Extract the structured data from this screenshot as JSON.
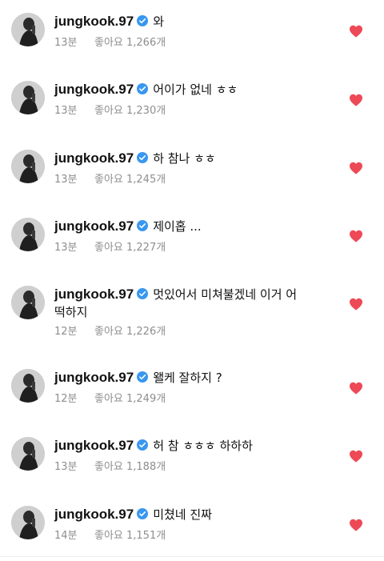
{
  "colors": {
    "heart": "#ed4956",
    "verified": "#3897f0",
    "meta_text": "#8e8e8e"
  },
  "comments": [
    {
      "username": "jungkook.97",
      "text": "와",
      "time": "13분",
      "likes": "좋아요 1,266개"
    },
    {
      "username": "jungkook.97",
      "text": "어이가 없네 ㅎㅎ",
      "time": "13분",
      "likes": "좋아요 1,230개"
    },
    {
      "username": "jungkook.97",
      "text": "하 참나 ㅎㅎ",
      "time": "13분",
      "likes": "좋아요 1,245개"
    },
    {
      "username": "jungkook.97",
      "text": "제이홉 ...",
      "time": "13분",
      "likes": "좋아요 1,227개"
    },
    {
      "username": "jungkook.97",
      "text": "멋있어서 미쳐불겠네 이거 어",
      "text_line2": "떡하지",
      "time": "12분",
      "likes": "좋아요 1,226개"
    },
    {
      "username": "jungkook.97",
      "text": "왤케 잘하지 ?",
      "time": "12분",
      "likes": "좋아요 1,249개"
    },
    {
      "username": "jungkook.97",
      "text": "허 참 ㅎㅎㅎ 하하하",
      "time": "13분",
      "likes": "좋아요 1,188개"
    },
    {
      "username": "jungkook.97",
      "text": "미쳤네 진짜",
      "time": "14분",
      "likes": "좋아요 1,151개"
    }
  ],
  "icons": {
    "avatar": "profile-photo",
    "verified": "verified-badge-icon",
    "like": "heart-icon"
  }
}
